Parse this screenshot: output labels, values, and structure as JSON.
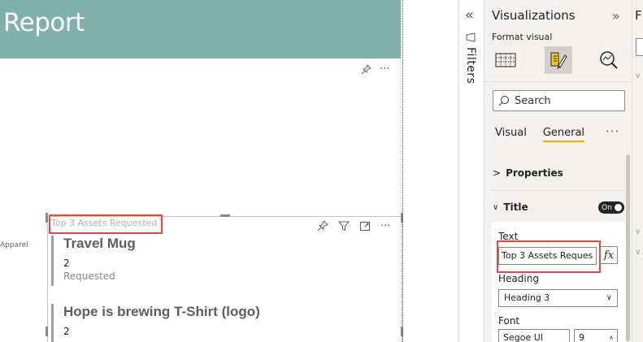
{
  "report": {
    "title": "Report",
    "side_label": "Apparel"
  },
  "visual": {
    "title": "Top 3 Assets Requested",
    "cards": [
      {
        "name": "Travel Mug",
        "value": "2",
        "sub": "Requested"
      },
      {
        "name": "Hope is brewing T-Shirt (logo)",
        "value": "2"
      }
    ]
  },
  "filters_pane": {
    "label": "Filters"
  },
  "viz_pane": {
    "title": "Visualizations",
    "format_label": "Format visual",
    "search_placeholder": "Search",
    "tabs": [
      "Visual",
      "General"
    ],
    "active_tab": "General",
    "more": "···",
    "sections": {
      "properties": "Properties",
      "title": "Title"
    },
    "title_toggle": "On",
    "fields": {
      "text_label": "Text",
      "text_value": "Top 3 Assets Reques",
      "fx": "fx",
      "heading_label": "Heading",
      "heading_value": "Heading 3",
      "font_label": "Font",
      "font_value": "Segoe UI",
      "font_size": "9"
    }
  },
  "fields_pane": {
    "letter": "F"
  },
  "colors": {
    "banner": "#7fb0aa",
    "highlight": "#e8473f",
    "active_tab_underline": "#e8b000"
  }
}
